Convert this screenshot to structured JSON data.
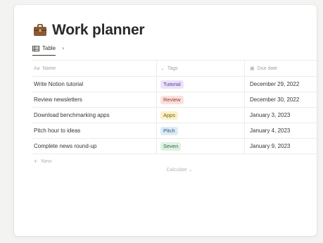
{
  "page": {
    "title": "Work planner",
    "icon": "briefcase-icon"
  },
  "views": {
    "tab_label": "Table",
    "tab_icon": "table-icon",
    "more_icon": "chevron-down-icon"
  },
  "table": {
    "columns": [
      {
        "label": "Name",
        "icon": "text-icon"
      },
      {
        "label": "Tags",
        "icon": "chevron-circle-icon"
      },
      {
        "label": "Due date",
        "icon": "calendar-icon"
      }
    ],
    "rows": [
      {
        "name": "Write Notion tutorial",
        "tag": "Tutorial",
        "tag_bg": "#ece3fb",
        "tag_fg": "#5b3c8a",
        "date": "December 29, 2022"
      },
      {
        "name": "Review newsletters",
        "tag": "Review",
        "tag_bg": "#fbe0dd",
        "tag_fg": "#8f3a30",
        "date": "December 30, 2022"
      },
      {
        "name": "Download benchmarking apps",
        "tag": "Apps",
        "tag_bg": "#fbf1c9",
        "tag_fg": "#7a5b12",
        "date": "January 3, 2023"
      },
      {
        "name": "Pitch hour to ideas",
        "tag": "Pitch",
        "tag_bg": "#dcecf6",
        "tag_fg": "#2f5a7a",
        "date": "January 4, 2023"
      },
      {
        "name": "Complete news round-up",
        "tag": "Seven",
        "tag_bg": "#dff0e4",
        "tag_fg": "#2f6b44",
        "date": "January 9, 2023"
      }
    ],
    "new_label": "New",
    "calculate_label": "Calculate"
  }
}
